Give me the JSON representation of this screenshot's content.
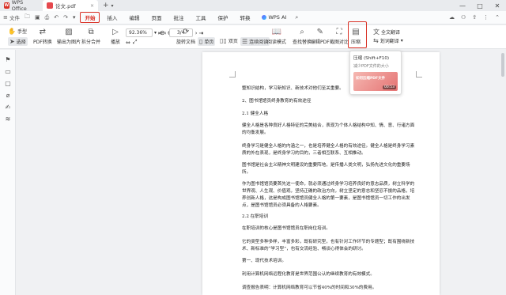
{
  "titlebar": {
    "home_tab": "WPS Office",
    "doc_tab": "论文.pdf",
    "new_tab_glyph": "+",
    "new_tab_dropdown_glyph": "▾",
    "tab_close_glyph": "×",
    "minimize_glyph": "—",
    "maximize_glyph": "□",
    "close_glyph": "✕"
  },
  "menubar": {
    "file_label": "文件",
    "items": [
      "开始",
      "插入",
      "编辑",
      "页面",
      "批注",
      "工具",
      "保护",
      "转换"
    ],
    "active": "开始",
    "wps_ai": "WPS AI"
  },
  "toolbar": {
    "hand_label": "手型",
    "select_label": "选择",
    "pdf_convert_label": "PDF转换",
    "export_image_label": "输出为图片",
    "split_merge_label": "拆分合并",
    "play_label": "播放",
    "zoom_value": "92.36%",
    "page_value": "3/4",
    "rotate_doc_label": "旋转文档",
    "single_page_label": "单页",
    "double_page_label": "双页",
    "continuous_label": "连续阅读",
    "read_mode_label": "阅读模式",
    "find_replace_label": "查找替换",
    "edit_pdf_label": "编辑PDF",
    "screenshot_compare_label": "截图对比",
    "compress_label": "压缩",
    "full_translate_label": "全文翻译",
    "partial_translate_label": "划词翻译"
  },
  "tooltip": {
    "title": "压缩 (Shift+F10)",
    "desc": "减少PDF文件的大小",
    "video_caption": "如何压缩PDF文件",
    "duration": "00:53"
  },
  "document": {
    "lines": [
      "整知识结构，学习新知识、新技术对他们至关重要。",
      "2、图书馆馆员终身教育的有效途径",
      "2.1 健全人格",
      "健全人格是各种良好人格特征的完美结合，表现为个体人格结构中知、情、意、行诸方面的均衡发展。",
      "终身学习是健全人格的内涵之一，也是培养健全人格的有效途径。健全人格是终身学习素质的外在表现，是终身学习的目的，三者相互联系、互相推动。",
      "图书馆是社会主义精神文明建设的重要阵地，是传播人类文明，弘扬先进文化的重要场所。",
      "作为图书馆馆员要首先这一使命，就必须通过终身学习培养良好的意志品质，树立科学的世界观、人生观、价值观，坚持正确的政治方向，树立坚定的意志和坚忍不拔的品格，培养创新人格，这是构成图书馆馆员健全人格的第一要素，是图书馆馆员一切工作的出发点，是图书馆馆员必须具备的人格要素。",
      "2.2 在职培训",
      "在职培训的核心是图书馆馆员在职岗位培训。",
      "它的类型多种多样，丰富多彩，既有研究型，也有针对工作环节的专题型；既有围绕新技术、新标准的“学习型”，也有交流经验、畅谈心得体会的研讨。",
      "第一、现代技术培训。",
      "利用计算机网络远程化教育是世界范围公认的继续教育的有效模式。",
      "调查报告表明：计算机网络教育可以节省40%的时间和30%的费用。"
    ]
  }
}
